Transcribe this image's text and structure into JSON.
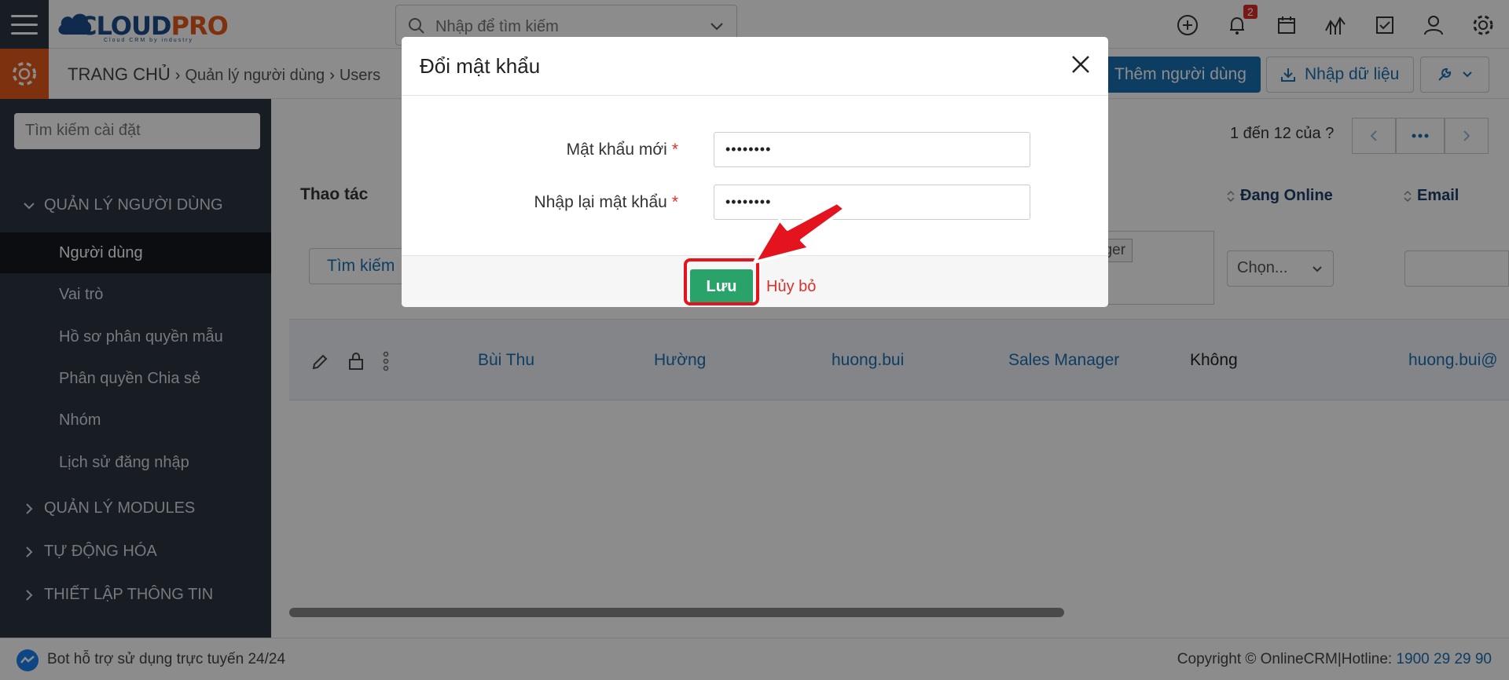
{
  "header": {
    "logo": {
      "brand_part1": "CLOUD",
      "brand_part2": "PRO",
      "tagline": "Cloud CRM by industry"
    },
    "search_placeholder": "Nhập để tìm kiếm",
    "notification_count": "2",
    "icons": [
      "plus-circle-icon",
      "bell-icon",
      "calendar-icon",
      "chart-icon",
      "checkbox-icon",
      "user-icon",
      "gear-icon"
    ]
  },
  "breadcrumb": {
    "home": "TRANG CHỦ",
    "level1": "Quản lý người dùng",
    "level2": "Users"
  },
  "toolbar": {
    "add_user_label": "Thêm người dùng",
    "import_label": "Nhập dữ liệu"
  },
  "sidebar": {
    "search_placeholder": "Tìm kiếm cài đặt",
    "groups": [
      {
        "label": "QUẢN LÝ NGƯỜI DÙNG",
        "expanded": true
      },
      {
        "label": "QUẢN LÝ MODULES",
        "expanded": false
      },
      {
        "label": "TỰ ĐỘNG HÓA",
        "expanded": false
      },
      {
        "label": "THIẾT LẬP THÔNG TIN",
        "expanded": false
      }
    ],
    "items": [
      {
        "label": "Người dùng",
        "active": true
      },
      {
        "label": "Vai trò"
      },
      {
        "label": "Hồ sơ phân quyền mẫu"
      },
      {
        "label": "Phân quyền Chia sẻ"
      },
      {
        "label": "Nhóm"
      },
      {
        "label": "Lịch sử đăng nhập"
      }
    ]
  },
  "list": {
    "pager_text": "1 đến 12 của",
    "pager_help": "?",
    "col_actions": "Thao tác",
    "columns": [
      "Đang Online",
      "Email"
    ],
    "filter_search_label": "Tìm kiếm",
    "filter_tag_label": "ager",
    "filter_online_placeholder": "Chọn...",
    "row": {
      "first_name": "Bùi Thu",
      "last_name": "Hường",
      "username": "huong.bui",
      "role": "Sales Manager",
      "online": "Không",
      "email": "huong.bui@"
    }
  },
  "footer": {
    "bot_text": "Bot hỗ trợ sử dụng trực tuyến 24/24",
    "copyright": "Copyright © OnlineCRM|Hotline:",
    "hotline": "1900 29 29 90"
  },
  "modal": {
    "title": "Đổi mật khẩu",
    "new_password_label": "Mật khẩu mới",
    "confirm_password_label": "Nhập lại mật khẩu",
    "required_mark": "*",
    "new_password_value": "••••••••",
    "confirm_password_value": "••••••••",
    "save_label": "Lưu",
    "cancel_label": "Hủy bỏ"
  },
  "colors": {
    "primary": "#1b6fb3",
    "accent_orange": "#e55a1c",
    "sidebar_bg": "#2c3440",
    "save_green": "#2aa36b",
    "danger": "#d9302b"
  }
}
